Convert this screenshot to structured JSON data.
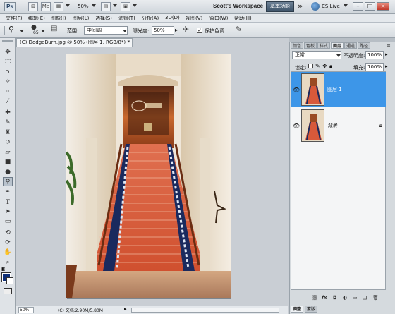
{
  "app": {
    "logo": "Ps",
    "zoom": "50%",
    "workspace_name": "Scott's Workspace",
    "essentials": "基本功能",
    "more": "»",
    "cs_live": "CS Live",
    "mb_label": "Mb"
  },
  "menu": [
    "文件(F)",
    "编辑(E)",
    "图像(I)",
    "图层(L)",
    "选择(S)",
    "滤镜(T)",
    "分析(A)",
    "3D(D)",
    "视图(V)",
    "窗口(W)",
    "帮助(H)"
  ],
  "options": {
    "brush_size": "65",
    "range_label": "范围:",
    "range_value": "中间调",
    "exposure_label": "曝光度:",
    "exposure_value": "50%",
    "protect_label": "保护色调",
    "protect_checked": "✓"
  },
  "document": {
    "tab_title": "(C) DodgeBurn.jpg @ 50% (图层 1, RGB/8*) *",
    "status_zoom": "50%",
    "status_doc": "(C) 文档:2.90M/5.80M"
  },
  "panels": {
    "tabs": [
      "颜色",
      "色板",
      "样式",
      "图层",
      "通道",
      "路径"
    ],
    "active_tab": "图层",
    "blend_mode": "正常",
    "opacity_label": "不透明度:",
    "opacity_value": "100%",
    "lock_label": "锁定:",
    "fill_label": "填充:",
    "fill_value": "100%",
    "layers": [
      {
        "name": "图层 1",
        "selected": true
      },
      {
        "name": "背景",
        "selected": false,
        "locked": true
      }
    ],
    "footer_icons": [
      "link-icon",
      "fx-icon",
      "mask-icon",
      "adjustment-icon",
      "folder-icon",
      "new-layer-icon",
      "trash-icon"
    ],
    "bottom_tabs": [
      "调整",
      "蒙版"
    ]
  },
  "colors": {
    "selected_layer": "#3d96e8",
    "foreground": "#0e2f78"
  }
}
